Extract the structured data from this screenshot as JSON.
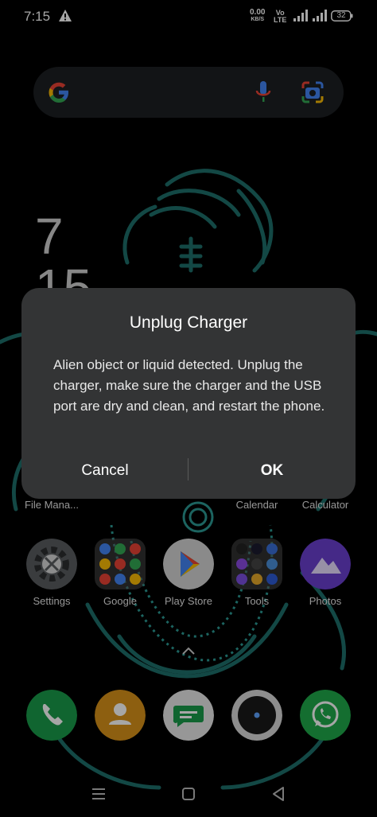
{
  "status_bar": {
    "time": "7:15",
    "net_speed_value": "0.00",
    "net_speed_unit": "KB/S",
    "volte_top": "Vo",
    "volte_bottom": "LTE",
    "battery": "32"
  },
  "clock_widget": {
    "hour": "7",
    "minute": "15"
  },
  "dialog": {
    "title": "Unplug Charger",
    "message": "Alien object or liquid detected. Unplug the charger, make sure the charger and the USB port are dry and clean, and restart the phone.",
    "cancel_label": "Cancel",
    "ok_label": "OK"
  },
  "home_row_top": {
    "labels": [
      "File Mana...",
      "Calendar",
      "Calculator"
    ]
  },
  "home_row_apps": [
    {
      "label": "Settings"
    },
    {
      "label": "Google"
    },
    {
      "label": "Play Store"
    },
    {
      "label": "Tools"
    },
    {
      "label": "Photos"
    }
  ],
  "dock": [
    "phone",
    "contacts",
    "messages",
    "camera",
    "whatsapp"
  ],
  "colors": {
    "dialog_bg": "#333435",
    "wallpaper_line": "#1e6f6b",
    "phone_green": "#1a9b4a",
    "contacts_orange": "#d9931a",
    "photos_purple": "#6a3fd0"
  }
}
